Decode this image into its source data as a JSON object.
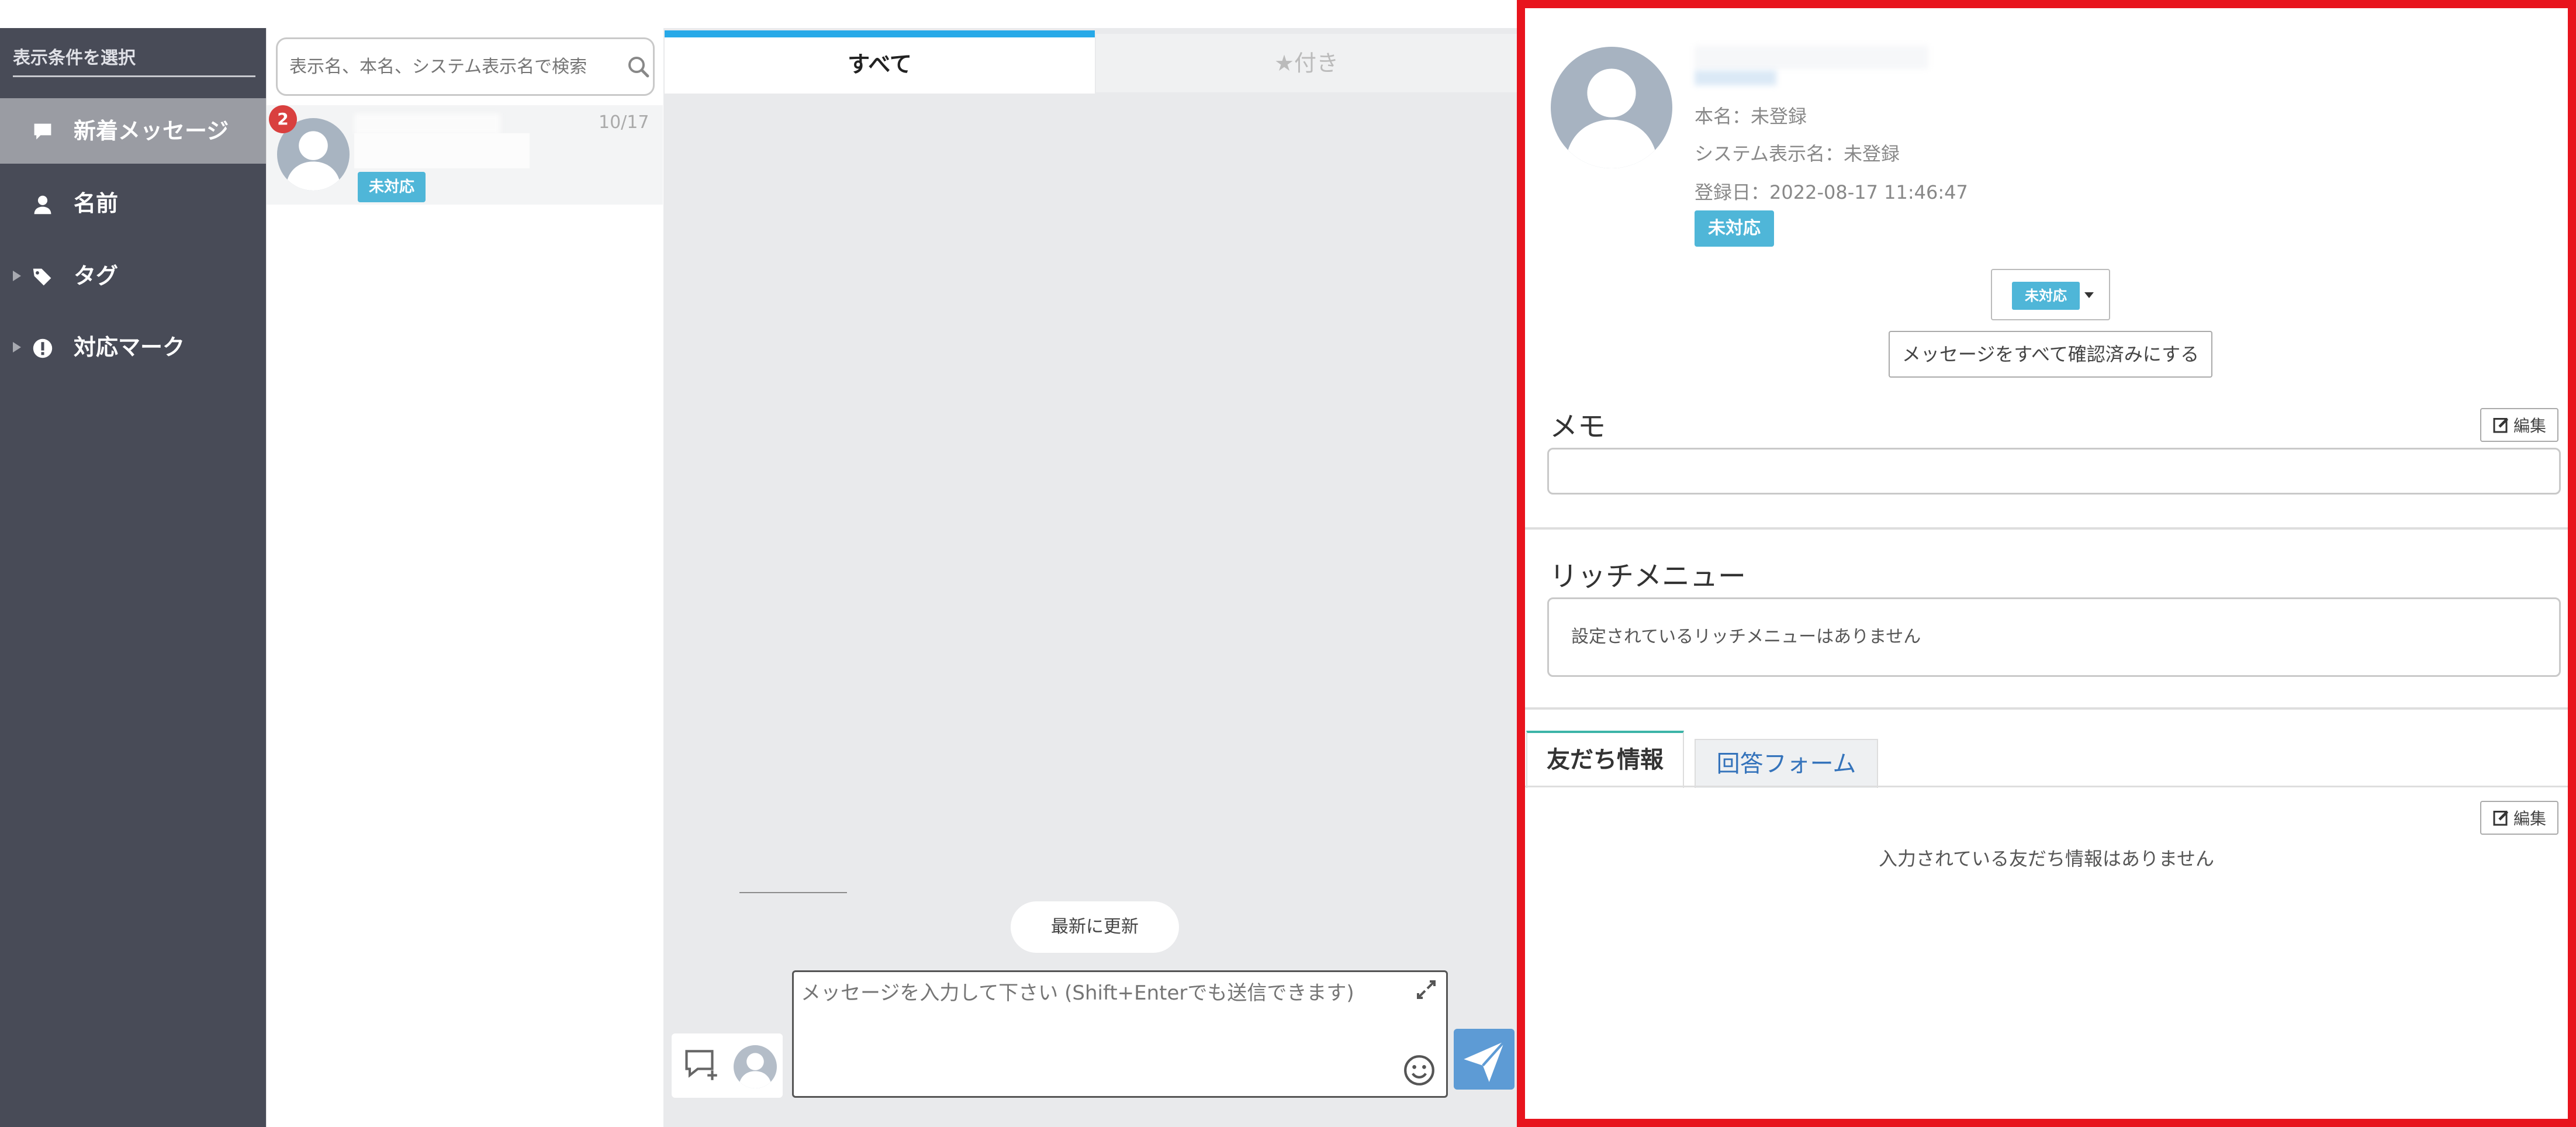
{
  "sidebar": {
    "header": "表示条件を選択",
    "items": [
      {
        "label": "新着メッセージ",
        "icon": "speech-bubble-icon",
        "active": true
      },
      {
        "label": "名前",
        "icon": "person-icon"
      },
      {
        "label": "タグ",
        "icon": "tag-icon",
        "expandable": true
      },
      {
        "label": "対応マーク",
        "icon": "exclamation-icon",
        "expandable": true
      }
    ]
  },
  "list": {
    "search_placeholder": "表示名、本名、システム表示名で検索",
    "conversations": [
      {
        "badge": "2",
        "date": "10/17",
        "status": "未対応"
      }
    ]
  },
  "chat": {
    "tabs": [
      {
        "label": "すべて",
        "active": true
      },
      {
        "label": "★付き"
      }
    ],
    "refresh_label": "最新に更新",
    "message_placeholder": "メッセージを入力して下さい (Shift+Enterでも送信できます)"
  },
  "detail": {
    "real_name": "本名：未登録",
    "system_name": "システム表示名：未登録",
    "registered": "登録日：2022-08-17 11:46:47",
    "status_tag": "未対応",
    "status_dropdown_value": "未対応",
    "mark_all_read": "メッセージをすべて確認済みにする",
    "memo_title": "メモ",
    "edit_label": "編集",
    "rich_menu_title": "リッチメニュー",
    "rich_menu_empty": "設定されているリッチメニューはありません",
    "tabs": [
      {
        "label": "友だち情報",
        "active": true
      },
      {
        "label": "回答フォーム"
      }
    ],
    "friend_edit_label": "編集",
    "friend_empty": "入力されている友だち情報はありません"
  },
  "colors": {
    "sidebar_bg": "#484b57",
    "active_tab_accent": "#27a9e8",
    "status_tag": "#4fb6d8",
    "unread_badge": "#d9403f",
    "send_button": "#5d9bd5",
    "highlight_border": "#e8141d"
  }
}
